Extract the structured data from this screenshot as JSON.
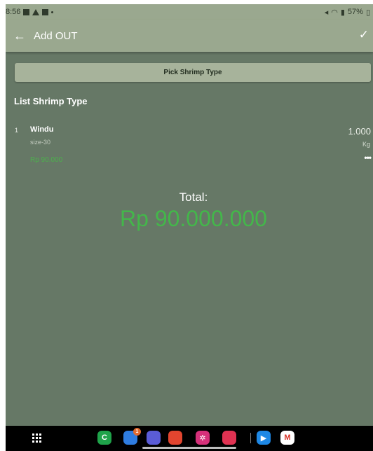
{
  "status_bar": {
    "time": "8:56",
    "right_text": "57%"
  },
  "app_bar": {
    "title": "Add OUT",
    "back_icon": "arrow-left-icon",
    "confirm_icon": "check-icon"
  },
  "pick_button": {
    "label": "Pick Shrimp Type"
  },
  "list_section": {
    "title": "List Shrimp Type",
    "items": [
      {
        "index": "1",
        "name": "Windu",
        "size": "size-30",
        "price": "Rp 90.000",
        "qty": "1.000",
        "unit": "Kg",
        "more": "•••"
      }
    ]
  },
  "total": {
    "label": "Total:",
    "value": "Rp 90.000.000"
  },
  "colors": {
    "background": "#667866",
    "app_bar": "#9aa88f",
    "accent_green": "#43b74a"
  },
  "nav": {
    "apps": [
      {
        "name": "phone-app-icon",
        "color": "#1fa34a",
        "glyph": "C"
      },
      {
        "name": "messages-app-icon",
        "color": "#2f7de1",
        "glyph": "",
        "badge": "1"
      },
      {
        "name": "internet-app-icon",
        "color": "#5a5cd6",
        "glyph": ""
      },
      {
        "name": "notes-app-icon",
        "color": "#e2452f",
        "glyph": ""
      },
      {
        "name": "gallery-app-icon",
        "color": "#d6307a",
        "glyph": "✲"
      },
      {
        "name": "camera-app-icon",
        "color": "#e03252",
        "glyph": ""
      },
      {
        "name": "play-store-app-icon",
        "color": "#1e88e5",
        "glyph": "▶"
      },
      {
        "name": "gmail-app-icon",
        "color": "#ffffff",
        "glyph": "M"
      }
    ]
  }
}
